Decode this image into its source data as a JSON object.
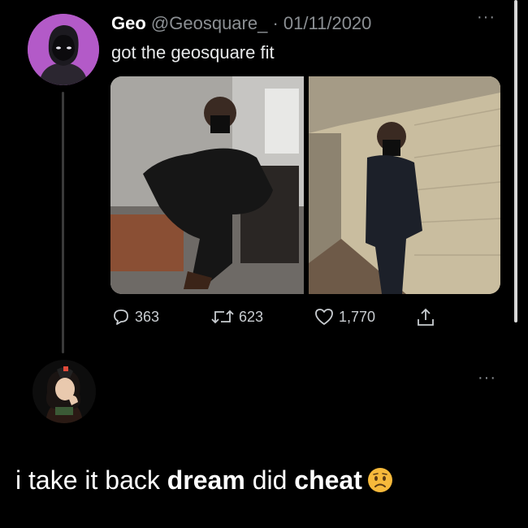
{
  "tweet": {
    "display_name": "Geo",
    "handle": "@Geosquare_",
    "separator": "·",
    "date": "01/11/2020",
    "text": "got the geosquare fit",
    "more_icon": "···",
    "stats": {
      "replies": "363",
      "retweets": "623",
      "likes": "1,770"
    }
  },
  "reply": {
    "more_icon": "···",
    "text_1": "i take it back ",
    "bold_1": "dream",
    "text_2": " did ",
    "bold_2": "cheat",
    "emoji": "worried-face"
  },
  "colors": {
    "background": "#000000",
    "muted_text": "#8b8f93",
    "avatar_1_bg": "#b35ac8",
    "emoji_yellow": "#f6b93b"
  }
}
